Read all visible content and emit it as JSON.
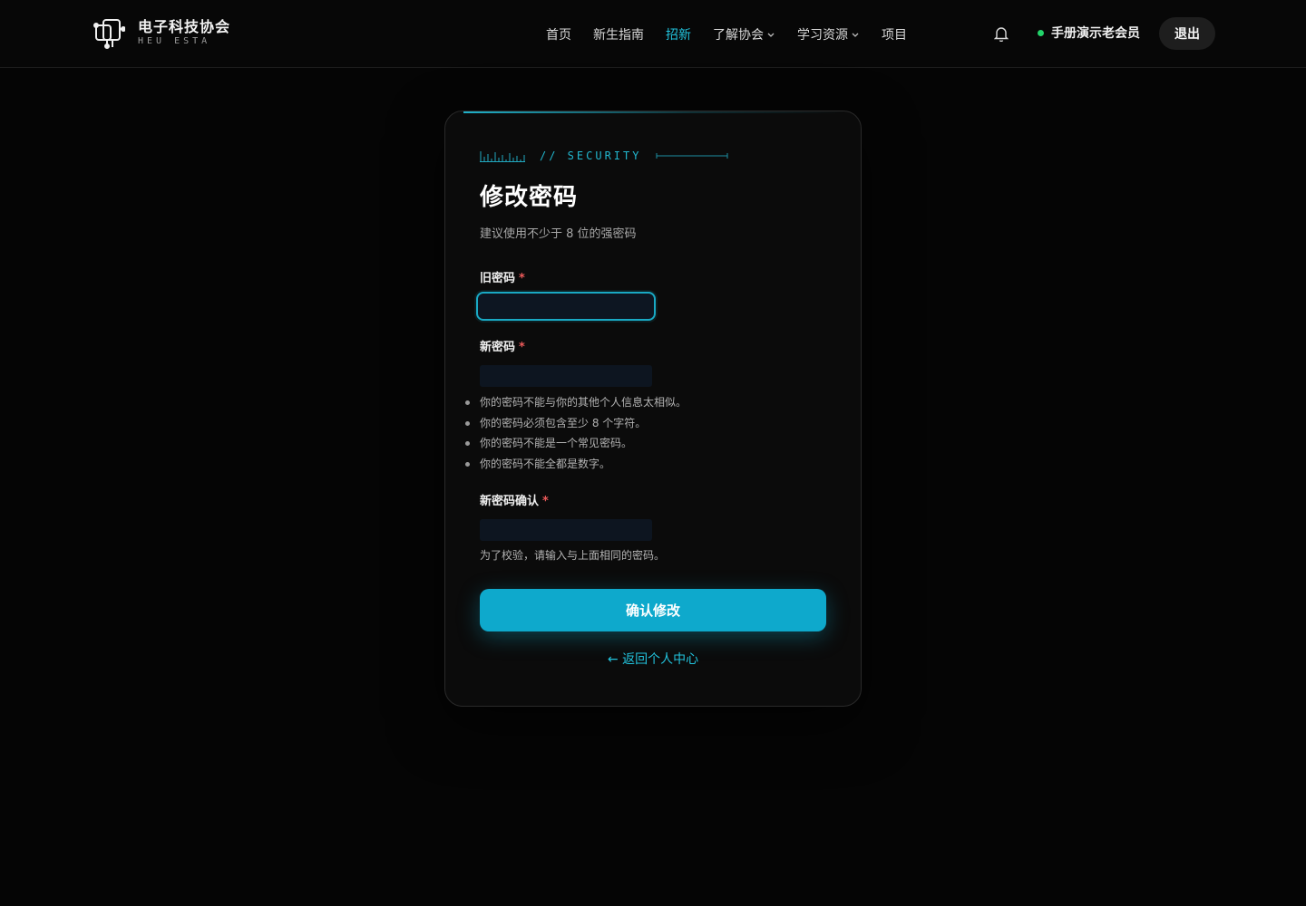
{
  "header": {
    "brand_name": "电子科技协会",
    "brand_sub": "HEU ESTA",
    "nav": [
      {
        "label": "首页",
        "active": false,
        "dropdown": false
      },
      {
        "label": "新生指南",
        "active": false,
        "dropdown": false
      },
      {
        "label": "招新",
        "active": true,
        "dropdown": false
      },
      {
        "label": "了解协会",
        "active": false,
        "dropdown": true
      },
      {
        "label": "学习资源",
        "active": false,
        "dropdown": true
      },
      {
        "label": "项目",
        "active": false,
        "dropdown": false
      }
    ],
    "notification_icon": "bell-icon",
    "user_name": "手册演示老会员",
    "user_status_color": "#22d36a",
    "logout_label": "退出"
  },
  "card": {
    "kicker": "// SECURITY",
    "title": "修改密码",
    "subtitle": "建议使用不少于 8 位的强密码",
    "fields": {
      "old_password": {
        "label": "旧密码",
        "required_mark": "*",
        "value": ""
      },
      "new_password": {
        "label": "新密码",
        "required_mark": "*",
        "value": ""
      },
      "confirm_password": {
        "label": "新密码确认",
        "required_mark": "*",
        "value": "",
        "helper": "为了校验，请输入与上面相同的密码。"
      }
    },
    "rules": [
      "你的密码不能与你的其他个人信息太相似。",
      "你的密码必须包含至少 8 个字符。",
      "你的密码不能是一个常见密码。",
      "你的密码不能全都是数字。"
    ],
    "submit_label": "确认修改",
    "back_label": "← 返回个人中心"
  },
  "colors": {
    "accent": "#22c3dd",
    "button": "#0ea9cc",
    "required": "#ef5b5b",
    "background": "#050505"
  }
}
